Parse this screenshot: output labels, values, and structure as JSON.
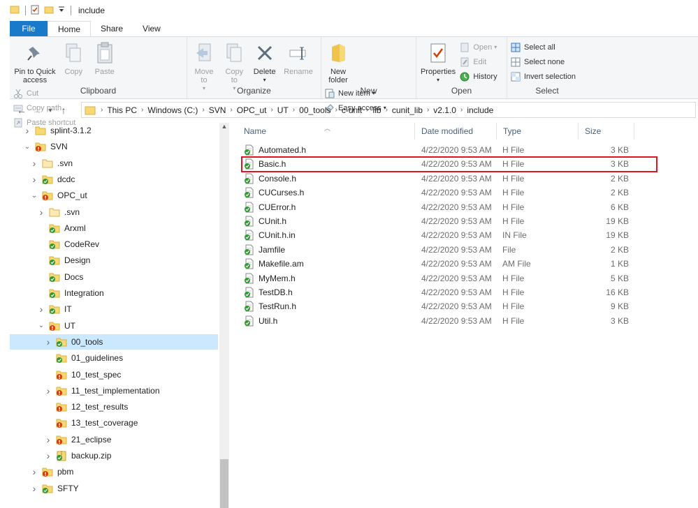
{
  "window": {
    "title": "include"
  },
  "ribbon_tabs": [
    "File",
    "Home",
    "Share",
    "View"
  ],
  "ribbon": {
    "clipboard": {
      "label": "Clipboard",
      "pin": "Pin to Quick access",
      "copy": "Copy",
      "paste": "Paste",
      "cut": "Cut",
      "copy_path": "Copy path",
      "paste_shortcut": "Paste shortcut"
    },
    "organize": {
      "label": "Organize",
      "move_to": "Move to",
      "copy_to": "Copy to",
      "delete": "Delete",
      "rename": "Rename"
    },
    "new": {
      "label": "New",
      "new_folder": "New folder",
      "new_item": "New item",
      "easy_access": "Easy access"
    },
    "open": {
      "label": "Open",
      "properties": "Properties",
      "open": "Open",
      "edit": "Edit",
      "history": "History"
    },
    "select": {
      "label": "Select",
      "select_all": "Select all",
      "select_none": "Select none",
      "invert": "Invert selection"
    }
  },
  "address": {
    "crumbs": [
      "This PC",
      "Windows (C:)",
      "SVN",
      "OPC_ut",
      "UT",
      "00_tools",
      "c-unit",
      "lib",
      "cunit_lib",
      "v2.1.0",
      "include"
    ]
  },
  "tree": [
    {
      "label": "splint-3.1.2",
      "icon": "folder",
      "chevron": "right"
    },
    {
      "label": "SVN",
      "icon": "folder-error",
      "chevron": "down"
    },
    {
      "label": ".svn",
      "icon": "folder-plain",
      "chevron": "right"
    },
    {
      "label": "dcdc",
      "icon": "folder-ok",
      "chevron": "right"
    },
    {
      "label": "OPC_ut",
      "icon": "folder-error",
      "chevron": "down"
    },
    {
      "label": ".svn",
      "icon": "folder-plain",
      "chevron": "right"
    },
    {
      "label": "Arxml",
      "icon": "folder-ok",
      "chevron": ""
    },
    {
      "label": "CodeRev",
      "icon": "folder-ok",
      "chevron": ""
    },
    {
      "label": "Design",
      "icon": "folder-ok",
      "chevron": ""
    },
    {
      "label": "Docs",
      "icon": "folder-ok",
      "chevron": ""
    },
    {
      "label": "Integration",
      "icon": "folder-ok",
      "chevron": ""
    },
    {
      "label": "IT",
      "icon": "folder-ok",
      "chevron": "right"
    },
    {
      "label": "UT",
      "icon": "folder-error",
      "chevron": "down"
    },
    {
      "label": "00_tools",
      "icon": "folder-ok",
      "chevron": "right",
      "selected": true
    },
    {
      "label": "01_guidelines",
      "icon": "folder-ok",
      "chevron": ""
    },
    {
      "label": "10_test_spec",
      "icon": "folder-error",
      "chevron": ""
    },
    {
      "label": "11_test_implementation",
      "icon": "folder-error",
      "chevron": "right"
    },
    {
      "label": "12_test_results",
      "icon": "folder-error",
      "chevron": ""
    },
    {
      "label": "13_test_coverage",
      "icon": "folder-error",
      "chevron": ""
    },
    {
      "label": "21_eclipse",
      "icon": "folder-error",
      "chevron": "right"
    },
    {
      "label": "backup.zip",
      "icon": "zip-ok",
      "chevron": "right"
    },
    {
      "label": "pbm",
      "icon": "folder-error",
      "chevron": "right"
    },
    {
      "label": "SFTY",
      "icon": "folder-ok",
      "chevron": "right"
    }
  ],
  "columns": {
    "name": "Name",
    "date": "Date modified",
    "type": "Type",
    "size": "Size"
  },
  "files": [
    {
      "name": "Automated.h",
      "date": "4/22/2020 9:53 AM",
      "type": "H File",
      "size": "3 KB"
    },
    {
      "name": "Basic.h",
      "date": "4/22/2020 9:53 AM",
      "type": "H File",
      "size": "3 KB",
      "highlighted": true
    },
    {
      "name": "Console.h",
      "date": "4/22/2020 9:53 AM",
      "type": "H File",
      "size": "2 KB"
    },
    {
      "name": "CUCurses.h",
      "date": "4/22/2020 9:53 AM",
      "type": "H File",
      "size": "2 KB"
    },
    {
      "name": "CUError.h",
      "date": "4/22/2020 9:53 AM",
      "type": "H File",
      "size": "6 KB"
    },
    {
      "name": "CUnit.h",
      "date": "4/22/2020 9:53 AM",
      "type": "H File",
      "size": "19 KB"
    },
    {
      "name": "CUnit.h.in",
      "date": "4/22/2020 9:53 AM",
      "type": "IN File",
      "size": "19 KB"
    },
    {
      "name": "Jamfile",
      "date": "4/22/2020 9:53 AM",
      "type": "File",
      "size": "2 KB"
    },
    {
      "name": "Makefile.am",
      "date": "4/22/2020 9:53 AM",
      "type": "AM File",
      "size": "1 KB"
    },
    {
      "name": "MyMem.h",
      "date": "4/22/2020 9:53 AM",
      "type": "H File",
      "size": "5 KB"
    },
    {
      "name": "TestDB.h",
      "date": "4/22/2020 9:53 AM",
      "type": "H File",
      "size": "16 KB"
    },
    {
      "name": "TestRun.h",
      "date": "4/22/2020 9:53 AM",
      "type": "H File",
      "size": "9 KB"
    },
    {
      "name": "Util.h",
      "date": "4/22/2020 9:53 AM",
      "type": "H File",
      "size": "3 KB"
    }
  ],
  "colors": {
    "accent": "#1979ca",
    "selection": "#cce8ff",
    "highlight_border": "#e0141e",
    "folder": "#f8d775",
    "svn_ok": "#2e9a2e",
    "svn_error": "#d83b01"
  }
}
